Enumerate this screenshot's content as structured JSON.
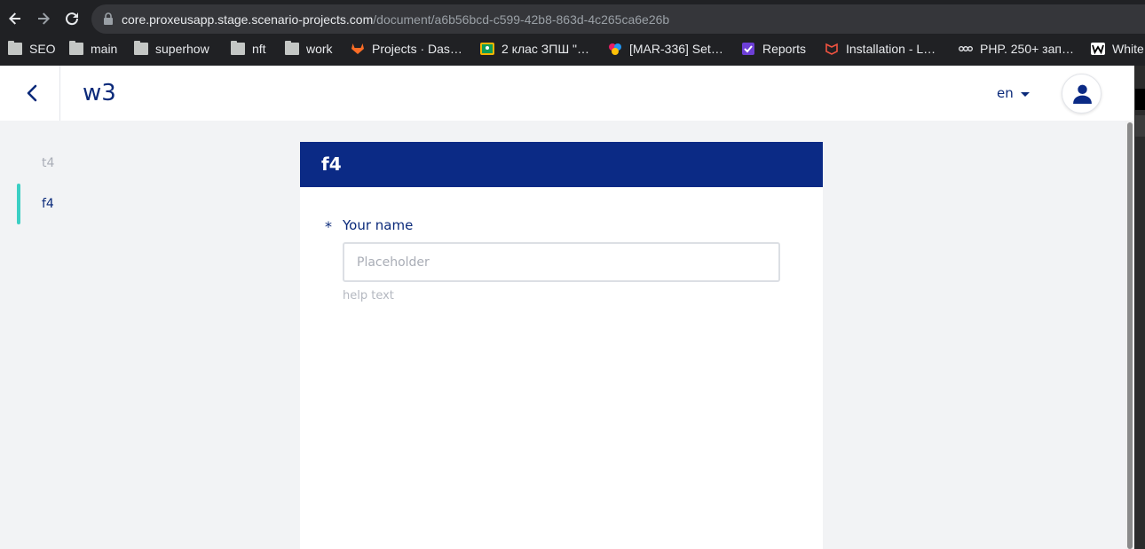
{
  "browser": {
    "url_host": "core.proxeusapp.stage.scenario-projects.com",
    "url_path": "/document/a6b56bcd-c599-42b8-863d-4c265ca6e26b",
    "bookmarks": [
      {
        "label": "SEO",
        "icon": "folder-icon"
      },
      {
        "label": "main",
        "icon": "folder-icon"
      },
      {
        "label": "superhow",
        "icon": "folder-icon"
      },
      {
        "label": "nft",
        "icon": "folder-icon"
      },
      {
        "label": "work",
        "icon": "folder-icon"
      },
      {
        "label": "Projects · Das…",
        "icon": "gitlab-icon"
      },
      {
        "label": "2 клас ЗПШ \"…",
        "icon": "classroom-icon"
      },
      {
        "label": "[MAR-336] Set…",
        "icon": "app-icon"
      },
      {
        "label": "Reports",
        "icon": "checkbox-icon"
      },
      {
        "label": "Installation - L…",
        "icon": "laravel-icon"
      },
      {
        "label": "PHP. 250+ зап…",
        "icon": "dou-icon"
      },
      {
        "label": "White",
        "icon": "w-icon"
      }
    ]
  },
  "header": {
    "title": "w3",
    "language": "en"
  },
  "steps": [
    {
      "label": "t4",
      "active": false
    },
    {
      "label": "f4",
      "active": true
    }
  ],
  "form": {
    "title": "f4",
    "required_mark": "*",
    "field_label": "Your name",
    "placeholder": "Placeholder",
    "help_text": "help text"
  },
  "colors": {
    "brand_navy": "#0b2a85",
    "accent_teal": "#3ccfc4"
  }
}
